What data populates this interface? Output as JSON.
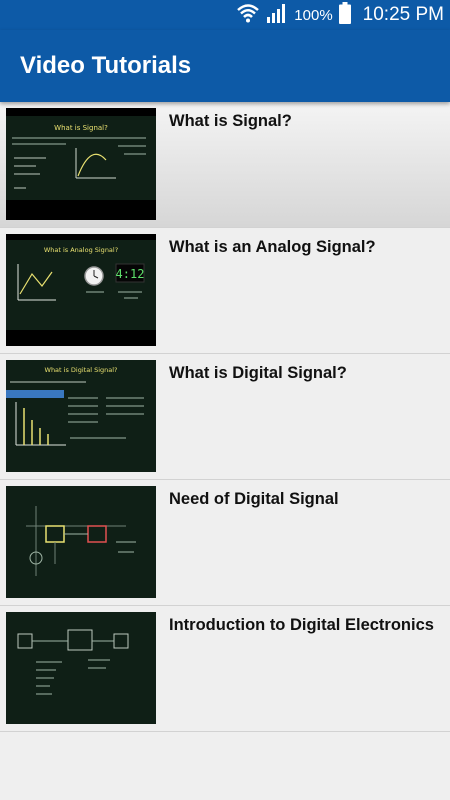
{
  "status_bar": {
    "battery_text": "100%",
    "time": "10:25 PM",
    "icons": [
      "wifi-icon",
      "signal-icon",
      "battery-icon"
    ]
  },
  "app_bar": {
    "title": "Video Tutorials"
  },
  "videos": [
    {
      "title": "What is Signal?",
      "thumb_heading": "What is Signal?"
    },
    {
      "title": "What is an Analog Signal?",
      "thumb_heading": "What is Analog Signal?",
      "clock_text": "4:12"
    },
    {
      "title": "What is Digital Signal?",
      "thumb_heading": "What is Digital Signal?"
    },
    {
      "title": "Need of Digital Signal"
    },
    {
      "title": "Introduction to Digital Electronics"
    }
  ],
  "colors": {
    "app_bar": "#0d5aa7",
    "list_background": "#efefef",
    "chalkboard": "#0f1f16"
  }
}
